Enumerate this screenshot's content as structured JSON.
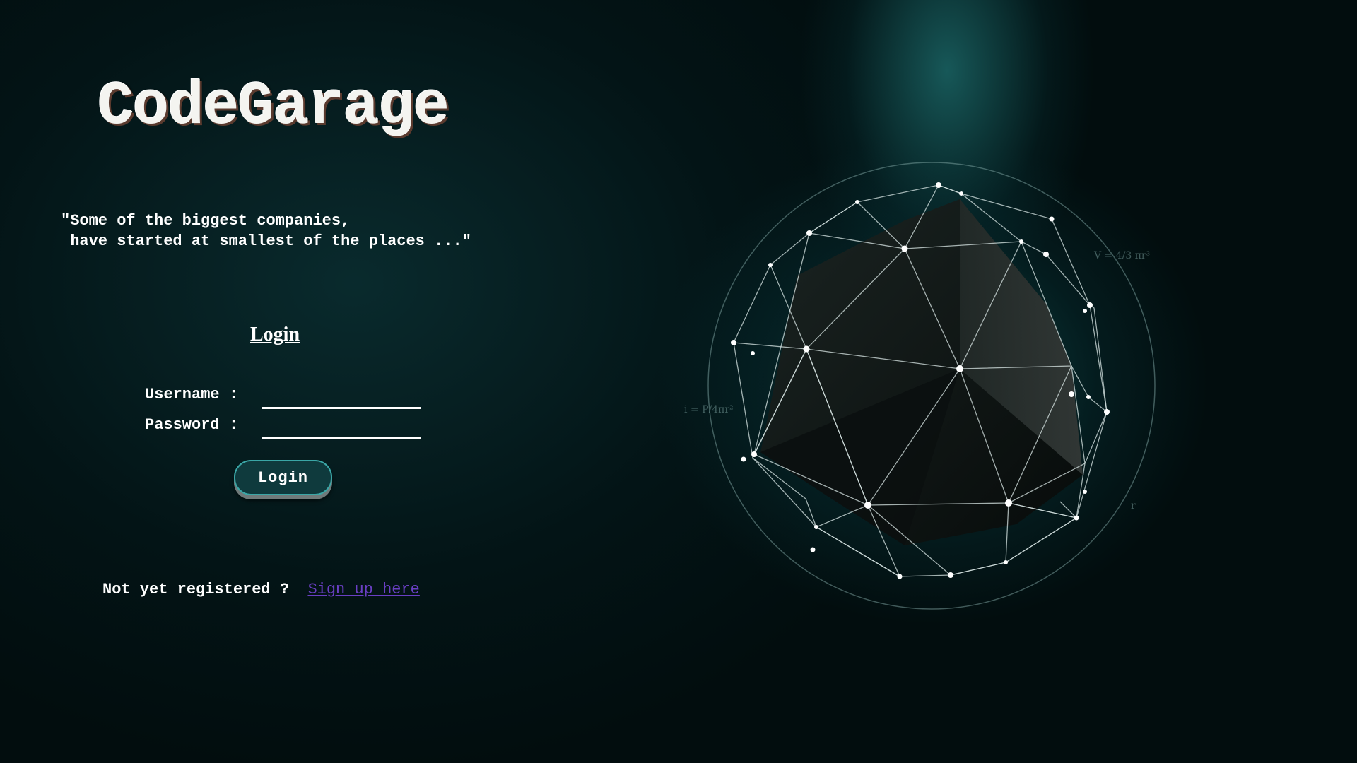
{
  "brand": {
    "logo_text": "CodeGarage"
  },
  "quote": {
    "text": "\"Some of the biggest companies,\n have started at smallest of the places ...\""
  },
  "login_form": {
    "heading": "Login",
    "username_label": "Username :",
    "username_value": "",
    "password_label": "Password :",
    "password_value": "",
    "submit_label": "Login"
  },
  "signup": {
    "prompt": "Not yet registered ?",
    "link_label": "Sign up here"
  },
  "colors": {
    "background": "#031314",
    "accent_teal": "#3aa6a6",
    "link": "#6a3fc4",
    "text": "#ffffff"
  },
  "illustration": {
    "icon": "polyhedron-network-sphere"
  }
}
